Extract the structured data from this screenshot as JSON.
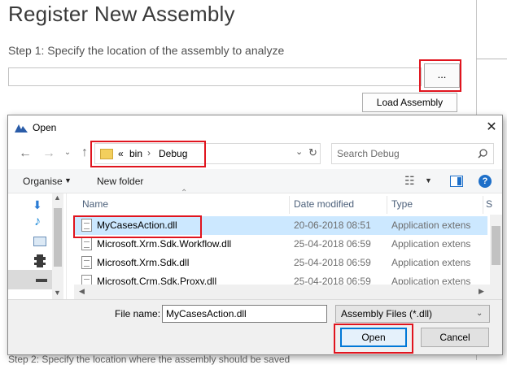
{
  "background": {
    "title": "Register New Assembly",
    "step1": "Step 1: Specify the location of the assembly to analyze",
    "browse_label": "...",
    "load_label": "Load Assembly",
    "bottom_text": "Step 2: Specify the location where the assembly should be saved"
  },
  "dialog": {
    "title": "Open",
    "address": {
      "prefix": "«",
      "parts": [
        "bin",
        "Debug"
      ]
    },
    "search_placeholder": "Search Debug",
    "toolbar": {
      "organise": "Organise",
      "new_folder": "New folder"
    },
    "columns": {
      "name": "Name",
      "date": "Date modified",
      "type": "Type",
      "size": "S"
    },
    "files": [
      {
        "name": "MyCasesAction.dll",
        "date": "20-06-2018 08:51",
        "type": "Application extens"
      },
      {
        "name": "Microsoft.Xrm.Sdk.Workflow.dll",
        "date": "25-04-2018 06:59",
        "type": "Application extens"
      },
      {
        "name": "Microsoft.Xrm.Sdk.dll",
        "date": "25-04-2018 06:59",
        "type": "Application extens"
      },
      {
        "name": "Microsoft.Crm.Sdk.Proxy.dll",
        "date": "25-04-2018 06:59",
        "type": "Application extens"
      }
    ],
    "file_name_label": "File name:",
    "file_name_value": "MyCasesAction.dll",
    "file_type_value": "Assembly Files (*.dll)",
    "open_label": "Open",
    "cancel_label": "Cancel"
  },
  "colors": {
    "highlight": "#e0141e",
    "selection": "#cce8ff",
    "accent": "#0078d7"
  }
}
